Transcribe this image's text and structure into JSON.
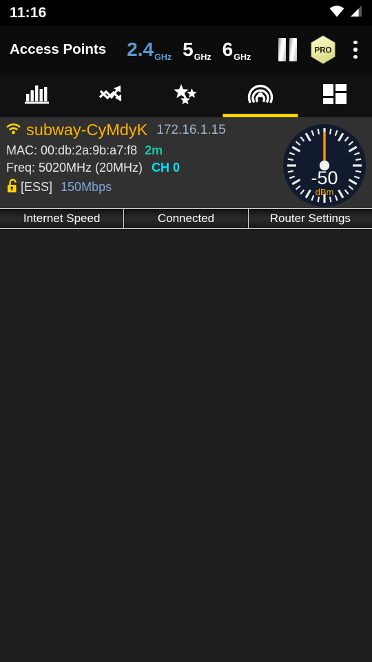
{
  "status_bar": {
    "clock": "11:16",
    "icons": [
      {
        "name": "wifi-icon"
      },
      {
        "name": "cellular-signal-icon"
      }
    ]
  },
  "title_bar": {
    "title": "Access Points",
    "bands": [
      {
        "number": "2.4",
        "unit": "GHz",
        "active": true
      },
      {
        "number": "5",
        "unit": "GHz",
        "active": false
      },
      {
        "number": "6",
        "unit": "GHz",
        "active": false
      }
    ],
    "pause_label": "pause-icon",
    "pro_label": "PRO",
    "overflow_label": "overflow-menu-icon"
  },
  "tabs": [
    {
      "name": "tab-bar-chart",
      "icon": "bar-chart-icon",
      "active": false
    },
    {
      "name": "tab-time-graph",
      "icon": "trend-lines-icon",
      "active": false
    },
    {
      "name": "tab-channel-rating",
      "icon": "stars-icon",
      "active": false
    },
    {
      "name": "tab-access-points",
      "icon": "radar-icon",
      "active": true
    },
    {
      "name": "tab-dashboard",
      "icon": "grid-icon",
      "active": false
    }
  ],
  "access_point": {
    "ssid": "subway-CyMdyK",
    "ip": "172.16.1.15",
    "mac": "MAC: 00:db:2a:9b:a7:f8",
    "distance": "2m",
    "frequency": "Freq: 5020MHz  (20MHz)",
    "channel": "CH 0",
    "capabilities": "[ESS]",
    "link_speed": "150Mbps",
    "gauge": {
      "value": "-50",
      "unit": "dBm",
      "needle_angle_deg": 0
    }
  },
  "action_buttons": [
    {
      "name": "internet-speed-button",
      "label": "Internet Speed"
    },
    {
      "name": "connected-button",
      "label": "Connected"
    },
    {
      "name": "router-settings-button",
      "label": "Router Settings"
    }
  ],
  "colors": {
    "accent_yellow": "#ffd200",
    "ssid_amber": "#ffb300",
    "band_active_blue": "#5b9bd5",
    "ip_blue": "#9fb3d0",
    "channel_cyan": "#00e5ff",
    "distance_teal": "#1cc4ae",
    "rate_blue": "#7da7d9",
    "gauge_face": "#121a2e",
    "card_bg": "#313131",
    "page_bg": "#1e1e1e"
  }
}
